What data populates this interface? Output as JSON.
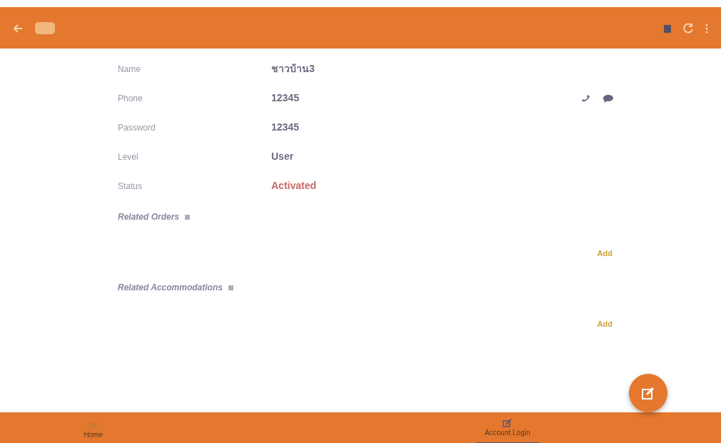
{
  "fields": [
    {
      "label": "Name",
      "value": "ชาวบ้าน3",
      "kind": "text"
    },
    {
      "label": "Phone",
      "value": "12345",
      "kind": "phone"
    },
    {
      "label": "Password",
      "value": "12345",
      "kind": "text"
    },
    {
      "label": "Level",
      "value": "User",
      "kind": "text"
    },
    {
      "label": "Status",
      "value": "Activated",
      "kind": "status"
    }
  ],
  "sections": [
    {
      "title": "Related Orders",
      "action": "Add"
    },
    {
      "title": "Related Accommodations",
      "action": "Add"
    }
  ],
  "bottom_nav": [
    {
      "label": "Home",
      "selected": false,
      "kind": "list"
    },
    {
      "label": "Account Login",
      "selected": true,
      "kind": "edit"
    }
  ]
}
